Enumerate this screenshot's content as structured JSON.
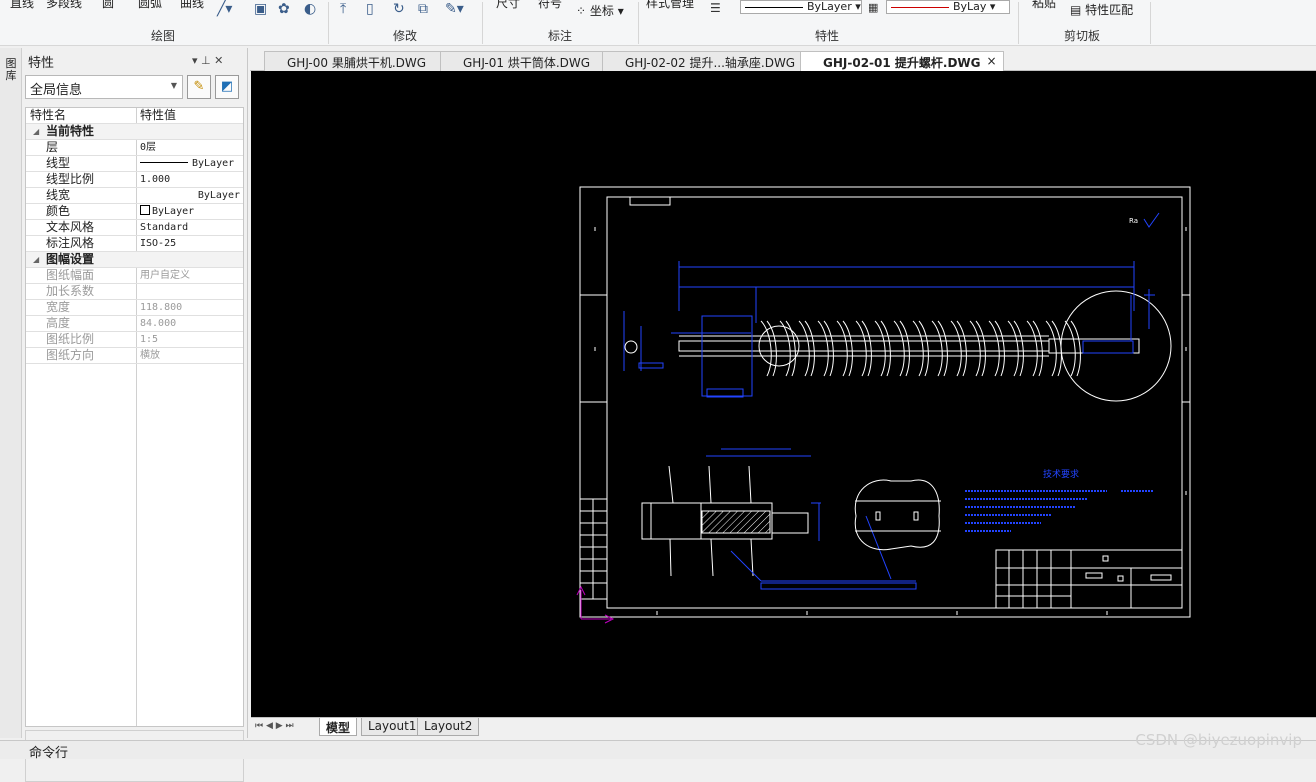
{
  "ribbon": {
    "top_labels": [
      "直线",
      "多段线",
      "圆",
      "圆弧",
      "曲线",
      "尺寸",
      "符号",
      "坐标",
      "样式管理",
      "粘贴",
      "特性匹配"
    ],
    "groups": [
      "绘图",
      "修改",
      "标注",
      "特性",
      "剪切板"
    ],
    "linetype_value": "ByLayer",
    "color_value": "ByLay"
  },
  "panel": {
    "vertical_label": "图库",
    "title": "特性",
    "pin_glyph": "▾  ⊥  ✕",
    "scope_value": "全局信息",
    "col_name": "特性名",
    "col_value": "特性值",
    "rows": [
      {
        "type": "cat",
        "name": "当前特性"
      },
      {
        "type": "row",
        "name": "层",
        "value": "0层"
      },
      {
        "type": "row",
        "name": "线型",
        "value": "ByLayer",
        "line": true
      },
      {
        "type": "row",
        "name": "线型比例",
        "value": "1.000"
      },
      {
        "type": "row",
        "name": "线宽",
        "value": "ByLayer",
        "right": true
      },
      {
        "type": "row",
        "name": "颜色",
        "value": "ByLayer",
        "swatch": true
      },
      {
        "type": "row",
        "name": "文本风格",
        "value": "Standard"
      },
      {
        "type": "row",
        "name": "标注风格",
        "value": "ISO-25"
      },
      {
        "type": "cat",
        "name": "图幅设置"
      },
      {
        "type": "dis",
        "name": "图纸幅面",
        "value": "用户自定义"
      },
      {
        "type": "dis",
        "name": "加长系数",
        "value": ""
      },
      {
        "type": "dis",
        "name": "宽度",
        "value": "118.800"
      },
      {
        "type": "dis",
        "name": "高度",
        "value": "84.000"
      },
      {
        "type": "dis",
        "name": "图纸比例",
        "value": "1:5"
      },
      {
        "type": "dis",
        "name": "图纸方向",
        "value": "横放"
      }
    ]
  },
  "doc_tabs": [
    {
      "label": "GHJ-00 果脯烘干机.DWG",
      "active": false
    },
    {
      "label": "GHJ-01 烘干筒体.DWG",
      "active": false
    },
    {
      "label": "GHJ-02-02 提升...轴承座.DWG",
      "active": false
    },
    {
      "label": "GHJ-02-01 提升螺杆.DWG",
      "active": true
    }
  ],
  "tab_close": "×",
  "layout_tabs": [
    {
      "label": "模型",
      "active": true
    },
    {
      "label": "Layout1",
      "active": false
    },
    {
      "label": "Layout2",
      "active": false
    }
  ],
  "nav_glyphs": "⏮ ◀ ▶ ⏭",
  "command_label": "命令行",
  "watermark": "CSDN @biyezuopinvip",
  "drawing_title": "技术要求"
}
